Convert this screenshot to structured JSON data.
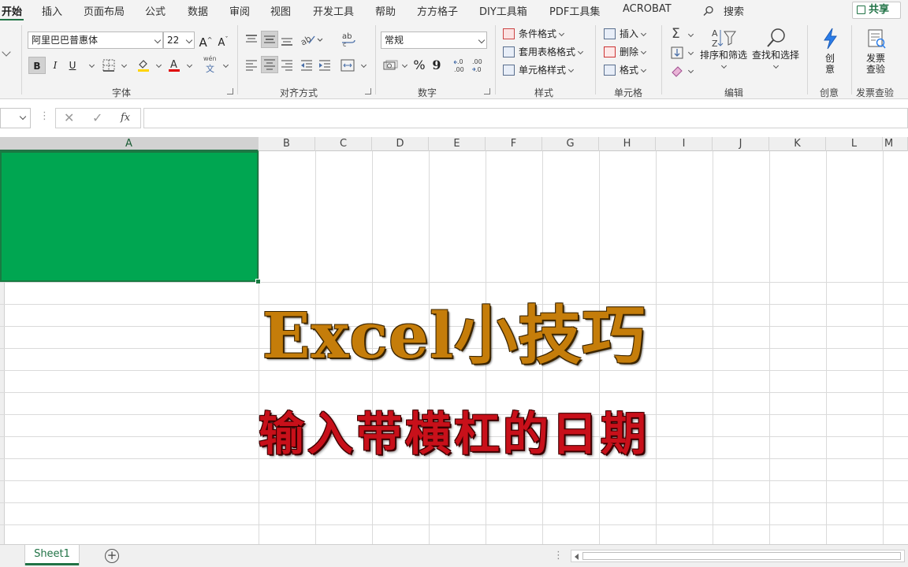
{
  "menu": {
    "tabs": [
      "开始",
      "插入",
      "页面布局",
      "公式",
      "数据",
      "审阅",
      "视图",
      "开发工具",
      "帮助",
      "方方格子",
      "DIY工具箱",
      "PDF工具集",
      "ACROBAT"
    ],
    "active": "开始",
    "search_label": "搜索",
    "share_label": "共享"
  },
  "ribbon": {
    "font": {
      "name": "阿里巴巴普惠体",
      "size": "22",
      "bold": "B",
      "italic": "I",
      "underline": "U",
      "phonetic": "wén",
      "label": "字体"
    },
    "alignment": {
      "label": "对齐方式"
    },
    "number": {
      "format": "常规",
      "percent": "%",
      "comma": "9",
      "label": "数字"
    },
    "styles": {
      "conditional": "条件格式",
      "table": "套用表格格式",
      "cell": "单元格样式",
      "label": "样式"
    },
    "cells": {
      "insert": "插入",
      "delete": "删除",
      "format": "格式",
      "label": "单元格"
    },
    "editing": {
      "sort_filter": "排序和筛选",
      "find_select": "查找和选择",
      "label": "编辑"
    },
    "creative": {
      "button": "创意",
      "label": "创意"
    },
    "invoice": {
      "button": "发票查验",
      "label": "发票查验"
    }
  },
  "formula_bar": {
    "cancel": "✕",
    "enter": "✓",
    "fx": "fx",
    "value": ""
  },
  "columns": [
    "A",
    "B",
    "C",
    "D",
    "E",
    "F",
    "G",
    "H",
    "I",
    "J",
    "K",
    "L",
    "M"
  ],
  "selected_cell_color": "#00a651",
  "overlay": {
    "title": "Excel小技巧",
    "subtitle": "输入带横杠的日期"
  },
  "sheets": {
    "tabs": [
      "Sheet1"
    ],
    "add": "+"
  },
  "colors": {
    "accent": "#217346",
    "title": "#c57d0a",
    "subtitle": "#c8101a"
  }
}
